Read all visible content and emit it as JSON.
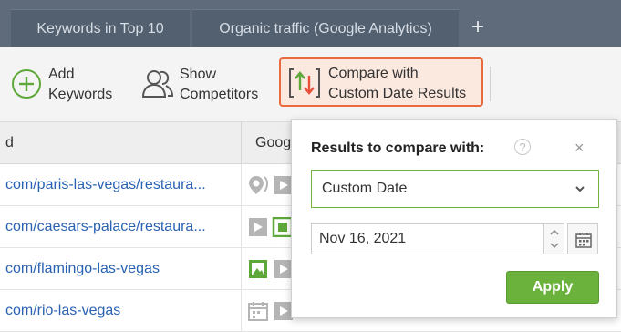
{
  "tabs": [
    {
      "label": "Keywords in Top 10"
    },
    {
      "label": "Organic traffic (Google Analytics)"
    }
  ],
  "tab_add": {
    "label": "+"
  },
  "toolbar": {
    "add_keywords": {
      "line1": "Add",
      "line2": "Keywords"
    },
    "show_competitors": {
      "line1": "Show",
      "line2": "Competitors"
    },
    "compare": {
      "line1": "Compare with",
      "line2": "Custom Date Results"
    }
  },
  "table": {
    "headers": [
      "d",
      "Goog"
    ],
    "rows": [
      {
        "url": "com/paris-las-vegas/restaura..."
      },
      {
        "url": "com/caesars-palace/restaura..."
      },
      {
        "url": "com/flamingo-las-vegas"
      },
      {
        "url": "com/rio-las-vegas"
      }
    ]
  },
  "popup": {
    "title": "Results to compare with:",
    "help": "?",
    "close": "×",
    "select_value": "Custom Date",
    "date_value": "Nov 16, 2021",
    "apply_label": "Apply"
  },
  "colors": {
    "accent_orange": "#e86a3e",
    "apply_green": "#6ab23b",
    "select_border": "#74b340",
    "link_blue": "#2a62b3",
    "tab_bg": "#536070"
  }
}
